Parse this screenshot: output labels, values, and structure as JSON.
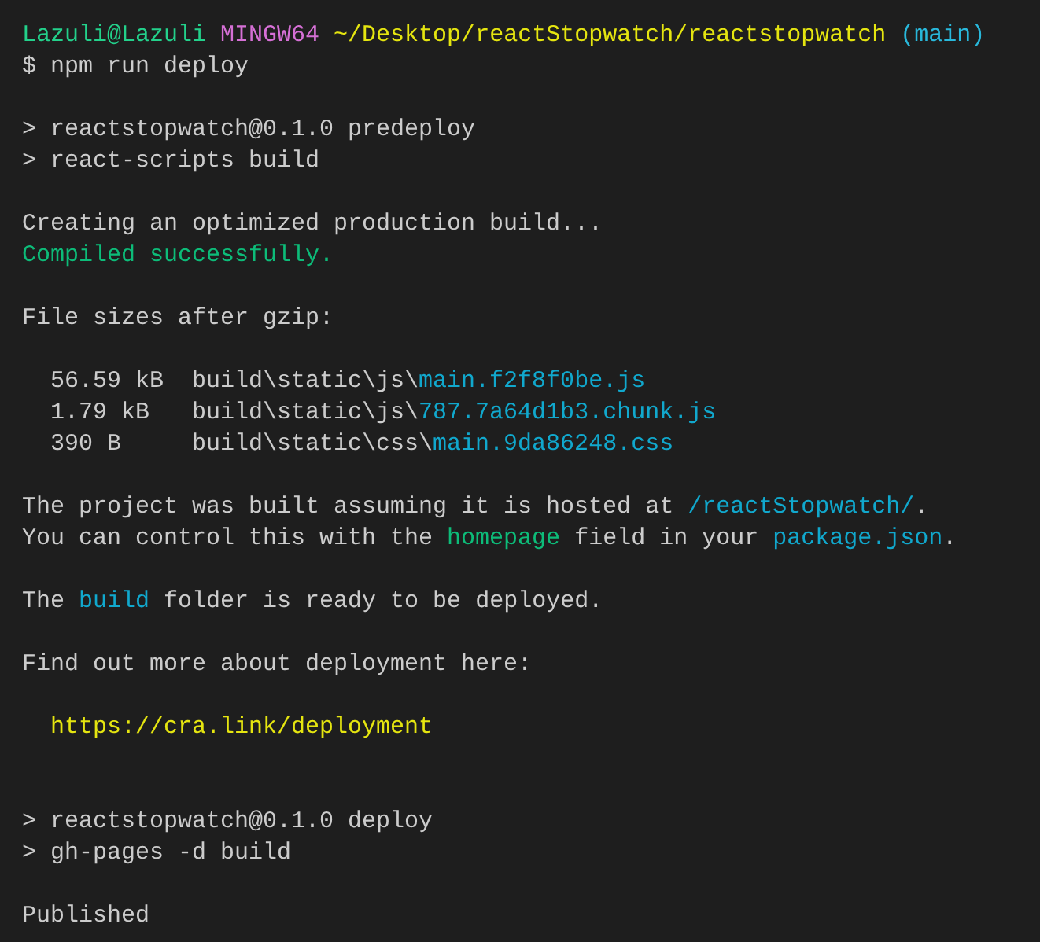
{
  "terminal": {
    "lines": [
      {
        "kind": "text",
        "segments": [
          {
            "text": "Lazuli@Lazuli",
            "color": "#23d18b"
          },
          {
            "text": " MINGW64",
            "color": "#d670d6"
          },
          {
            "text": " ~/Desktop/reactStopwatch/reactstopwatch",
            "color": "#e5e510"
          },
          {
            "text": " (main)",
            "color": "#29b8db"
          }
        ]
      },
      {
        "kind": "text",
        "segments": [
          {
            "text": "$ npm run deploy"
          }
        ]
      },
      {
        "kind": "blank"
      },
      {
        "kind": "text",
        "segments": [
          {
            "text": "> reactstopwatch@0.1.0 predeploy"
          }
        ]
      },
      {
        "kind": "text",
        "segments": [
          {
            "text": "> react-scripts build"
          }
        ]
      },
      {
        "kind": "blank"
      },
      {
        "kind": "text",
        "segments": [
          {
            "text": "Creating an optimized production build..."
          }
        ]
      },
      {
        "kind": "text",
        "segments": [
          {
            "text": "Compiled successfully.",
            "color": "#0dbc79"
          }
        ]
      },
      {
        "kind": "blank"
      },
      {
        "kind": "text",
        "segments": [
          {
            "text": "File sizes after gzip:"
          }
        ]
      },
      {
        "kind": "blank"
      },
      {
        "kind": "text",
        "segments": [
          {
            "text": "  56.59 kB  build\\static\\js\\"
          },
          {
            "text": "main.f2f8f0be.js",
            "color": "#11a8cd"
          }
        ]
      },
      {
        "kind": "text",
        "segments": [
          {
            "text": "  1.79 kB   build\\static\\js\\"
          },
          {
            "text": "787.7a64d1b3.chunk.js",
            "color": "#11a8cd"
          }
        ]
      },
      {
        "kind": "text",
        "segments": [
          {
            "text": "  390 B     build\\static\\css\\"
          },
          {
            "text": "main.9da86248.css",
            "color": "#11a8cd"
          }
        ]
      },
      {
        "kind": "blank"
      },
      {
        "kind": "text",
        "segments": [
          {
            "text": "The project was built assuming it is hosted at "
          },
          {
            "text": "/reactStopwatch/",
            "color": "#11a8cd"
          },
          {
            "text": "."
          }
        ]
      },
      {
        "kind": "text",
        "segments": [
          {
            "text": "You can control this with the "
          },
          {
            "text": "homepage",
            "color": "#0dbc79"
          },
          {
            "text": " field in your "
          },
          {
            "text": "package.json",
            "color": "#11a8cd"
          },
          {
            "text": "."
          }
        ]
      },
      {
        "kind": "blank"
      },
      {
        "kind": "text",
        "segments": [
          {
            "text": "The "
          },
          {
            "text": "build",
            "color": "#11a8cd"
          },
          {
            "text": " folder is ready to be deployed."
          }
        ]
      },
      {
        "kind": "blank"
      },
      {
        "kind": "text",
        "segments": [
          {
            "text": "Find out more about deployment here:"
          }
        ]
      },
      {
        "kind": "blank"
      },
      {
        "kind": "text",
        "segments": [
          {
            "text": "  https://cra.link/deployment",
            "color": "#e5e510"
          }
        ]
      },
      {
        "kind": "blank"
      },
      {
        "kind": "blank"
      },
      {
        "kind": "text",
        "segments": [
          {
            "text": "> reactstopwatch@0.1.0 deploy"
          }
        ]
      },
      {
        "kind": "text",
        "segments": [
          {
            "text": "> gh-pages -d build"
          }
        ]
      },
      {
        "kind": "blank"
      },
      {
        "kind": "text",
        "segments": [
          {
            "text": "Published"
          }
        ]
      }
    ]
  }
}
